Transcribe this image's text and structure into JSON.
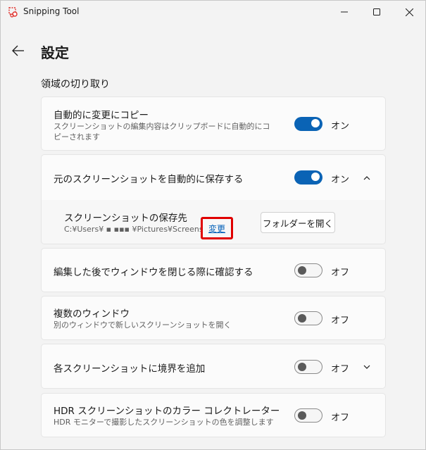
{
  "window": {
    "app_title": "Snipping Tool"
  },
  "header": {
    "page_title": "設定",
    "section_title": "領域の切り取り"
  },
  "settings": {
    "auto_copy": {
      "title": "自動的に変更にコピー",
      "description": "スクリーンショットの編集内容はクリップボードに自動的にコピーされます",
      "state": "オン",
      "enabled": true
    },
    "auto_save": {
      "title": "元のスクリーンショットを自動的に保存する",
      "state": "オン",
      "enabled": true,
      "expanded": true,
      "save_location": {
        "title": "スクリーンショットの保存先",
        "path": "C:¥Users¥ ▪ ▪▪▪ ¥Pictures¥Screenshots",
        "change_label": "変更",
        "open_folder_label": "フォルダーを開く"
      }
    },
    "confirm_close": {
      "title": "編集した後でウィンドウを閉じる際に確認する",
      "state": "オフ",
      "enabled": false
    },
    "multiple_windows": {
      "title": "複数のウィンドウ",
      "description": "別のウィンドウで新しいスクリーンショットを開く",
      "state": "オフ",
      "enabled": false
    },
    "add_border": {
      "title": "各スクリーンショットに境界を追加",
      "state": "オフ",
      "enabled": false
    },
    "hdr": {
      "title": "HDR スクリーンショットのカラー コレクトレーター",
      "description": "HDR モニターで撮影したスクリーンショットの色を調整します",
      "state": "オフ",
      "enabled": false
    }
  },
  "colors": {
    "accent": "#0a63b5",
    "highlight": "#e00000",
    "link": "#005fb8"
  }
}
